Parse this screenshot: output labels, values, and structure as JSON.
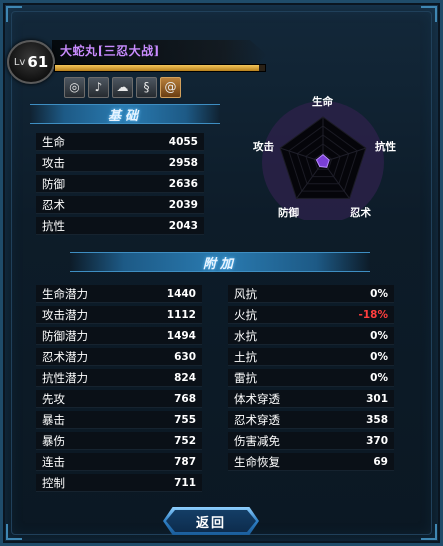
{
  "header": {
    "level_prefix": "Lv",
    "level": "61",
    "character_name": "大蛇丸[三忍大战]",
    "exp_fraction": 0.97
  },
  "skills": [
    {
      "icon": "wind-swirl-icon",
      "glyph": "◎"
    },
    {
      "icon": "note-icon",
      "glyph": "♪"
    },
    {
      "icon": "cloud-icon",
      "glyph": "☁"
    },
    {
      "icon": "wave-icon",
      "glyph": "§"
    },
    {
      "icon": "spiral-icon",
      "glyph": "@",
      "active": true
    }
  ],
  "basic": {
    "title": "基础",
    "stats": [
      {
        "label": "生命",
        "value": "4055"
      },
      {
        "label": "攻击",
        "value": "2958"
      },
      {
        "label": "防御",
        "value": "2636"
      },
      {
        "label": "忍术",
        "value": "2039"
      },
      {
        "label": "抗性",
        "value": "2043"
      }
    ]
  },
  "radar": {
    "labels": {
      "top": "生命",
      "right": "抗性",
      "bottom_right": "忍术",
      "bottom_left": "防御",
      "left": "攻击"
    },
    "values": [
      0.12,
      0.1,
      0.1,
      0.08,
      0.11
    ]
  },
  "extra": {
    "title": "附加",
    "left": [
      {
        "label": "生命潜力",
        "value": "1440"
      },
      {
        "label": "攻击潜力",
        "value": "1112"
      },
      {
        "label": "防御潜力",
        "value": "1494"
      },
      {
        "label": "忍术潜力",
        "value": "630"
      },
      {
        "label": "抗性潜力",
        "value": "824"
      },
      {
        "label": "先攻",
        "value": "768"
      },
      {
        "label": "暴击",
        "value": "755"
      },
      {
        "label": "暴伤",
        "value": "752"
      },
      {
        "label": "连击",
        "value": "787"
      },
      {
        "label": "控制",
        "value": "711"
      }
    ],
    "right": [
      {
        "label": "风抗",
        "value": "0%"
      },
      {
        "label": "火抗",
        "value": "-18%",
        "negative": true
      },
      {
        "label": "水抗",
        "value": "0%"
      },
      {
        "label": "土抗",
        "value": "0%"
      },
      {
        "label": "雷抗",
        "value": "0%"
      },
      {
        "label": "体术穿透",
        "value": "301"
      },
      {
        "label": "忍术穿透",
        "value": "358"
      },
      {
        "label": "伤害减免",
        "value": "370"
      },
      {
        "label": "生命恢复",
        "value": "69"
      }
    ]
  },
  "footer": {
    "back_label": "返回"
  },
  "colors": {
    "name": "#c98cff",
    "negative": "#ff3e3e",
    "radar_fill": "#7a3fd6"
  }
}
